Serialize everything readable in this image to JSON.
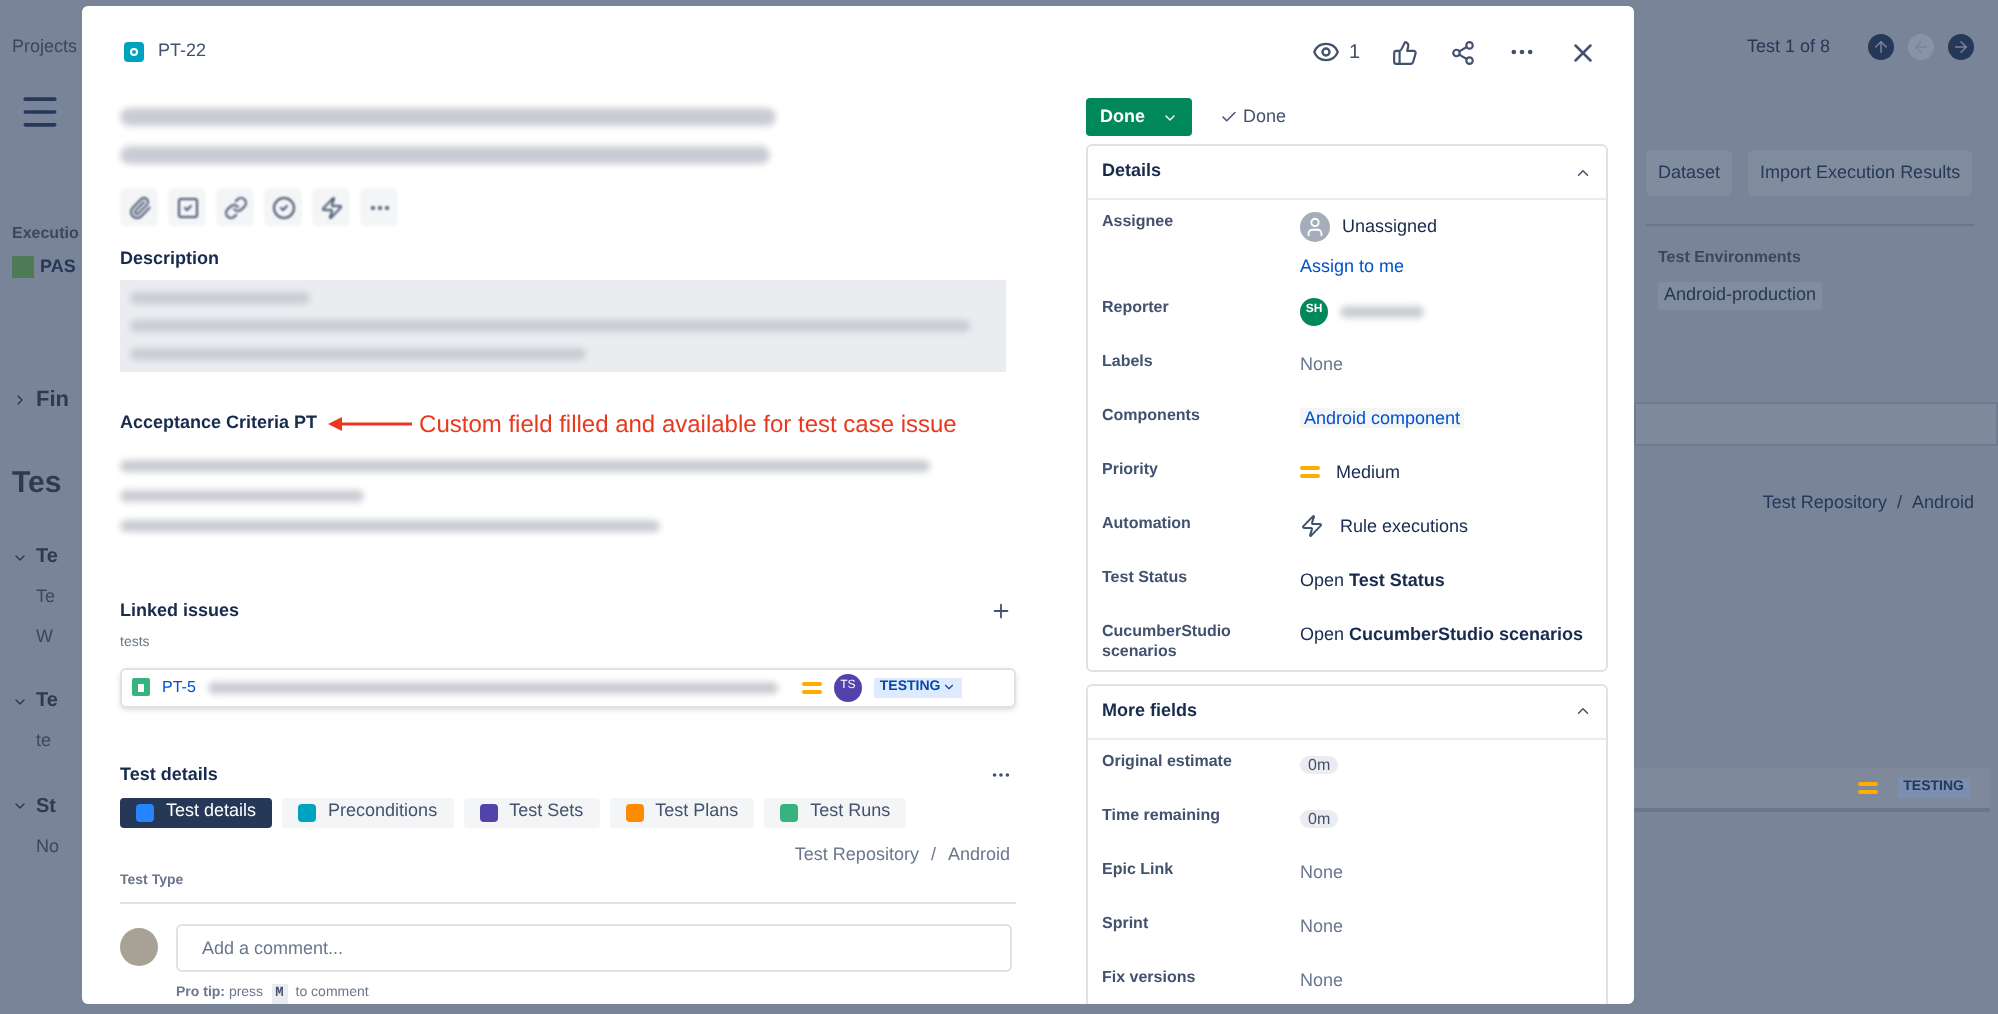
{
  "background": {
    "breadcrumb": "Projects",
    "execution_label": "Executio",
    "execution_status": "PAS",
    "left_fragments": [
      {
        "kind": "card",
        "text": "Fin"
      },
      {
        "kind": "heading",
        "text": "Tes"
      },
      {
        "kind": "section",
        "text": "Te"
      },
      {
        "kind": "line",
        "text": "Te"
      },
      {
        "kind": "line",
        "text": "W"
      },
      {
        "kind": "section",
        "text": "Te"
      },
      {
        "kind": "line",
        "text": "te"
      },
      {
        "kind": "section",
        "text": "St"
      },
      {
        "kind": "line",
        "text": "No"
      }
    ],
    "pager": "Test 1 of 8",
    "buttons": [
      "Dataset",
      "Import Execution Results"
    ],
    "environments_label": "Test Environments",
    "environment": "Android-production",
    "path": [
      "Test Repository",
      "Android"
    ],
    "path_separator": "/",
    "status": "TESTING"
  },
  "issue": {
    "key": "PT-22",
    "watchers": "1",
    "description_label": "Description",
    "criteria_label": "Acceptance Criteria PT",
    "annotation": "Custom field filled and available for test case issue",
    "linked": {
      "title": "Linked issues",
      "relation": "tests",
      "key": "PT-5",
      "assignee_initials": "TS",
      "status": "TESTING"
    },
    "test_details": {
      "title": "Test details",
      "tabs": [
        {
          "label": "Test details",
          "selected": true,
          "color": "#2684ff"
        },
        {
          "label": "Preconditions",
          "selected": false,
          "color": "#00a3bf"
        },
        {
          "label": "Test Sets",
          "selected": false,
          "color": "#5243aa"
        },
        {
          "label": "Test Plans",
          "selected": false,
          "color": "#ff8b00"
        },
        {
          "label": "Test Runs",
          "selected": false,
          "color": "#36b37e"
        }
      ],
      "path": [
        "Test Repository",
        "Android"
      ],
      "path_separator": "/",
      "test_type_label": "Test Type"
    },
    "comment": {
      "placeholder": "Add a comment...",
      "tip": "**Pro tip:** press",
      "key": "M",
      "tip_end": "to comment"
    },
    "status_button": "Done",
    "resolution": "Done",
    "details": {
      "title": "Details",
      "expanded": true,
      "fields": [
        {
          "label": "Assignee",
          "kind": "assignee",
          "value": "Unassigned",
          "link": "Assign to me"
        },
        {
          "label": "Reporter",
          "kind": "reporter",
          "initials": "SH"
        },
        {
          "label": "Labels",
          "kind": "empty",
          "value": "None"
        },
        {
          "label": "Components",
          "kind": "component",
          "value": "Android component"
        },
        {
          "label": "Priority",
          "kind": "priority",
          "value": "Medium"
        },
        {
          "label": "Automation",
          "kind": "automation",
          "value": "Rule executions"
        },
        {
          "label": "Test Status",
          "kind": "rich",
          "value": "Open **Test Status**"
        },
        {
          "label": "CucumberStudio scenarios",
          "kind": "rich",
          "value": "Open **CucumberStudio scenarios**"
        }
      ]
    },
    "more_fields": {
      "title": "More fields",
      "expanded": true,
      "fields": [
        {
          "label": "Original estimate",
          "kind": "duration",
          "value": "0m"
        },
        {
          "label": "Time remaining",
          "kind": "duration",
          "value": "0m"
        },
        {
          "label": "Epic Link",
          "kind": "empty",
          "value": "None"
        },
        {
          "label": "Sprint",
          "kind": "empty",
          "value": "None"
        },
        {
          "label": "Fix versions",
          "kind": "empty",
          "value": "None"
        }
      ]
    }
  }
}
